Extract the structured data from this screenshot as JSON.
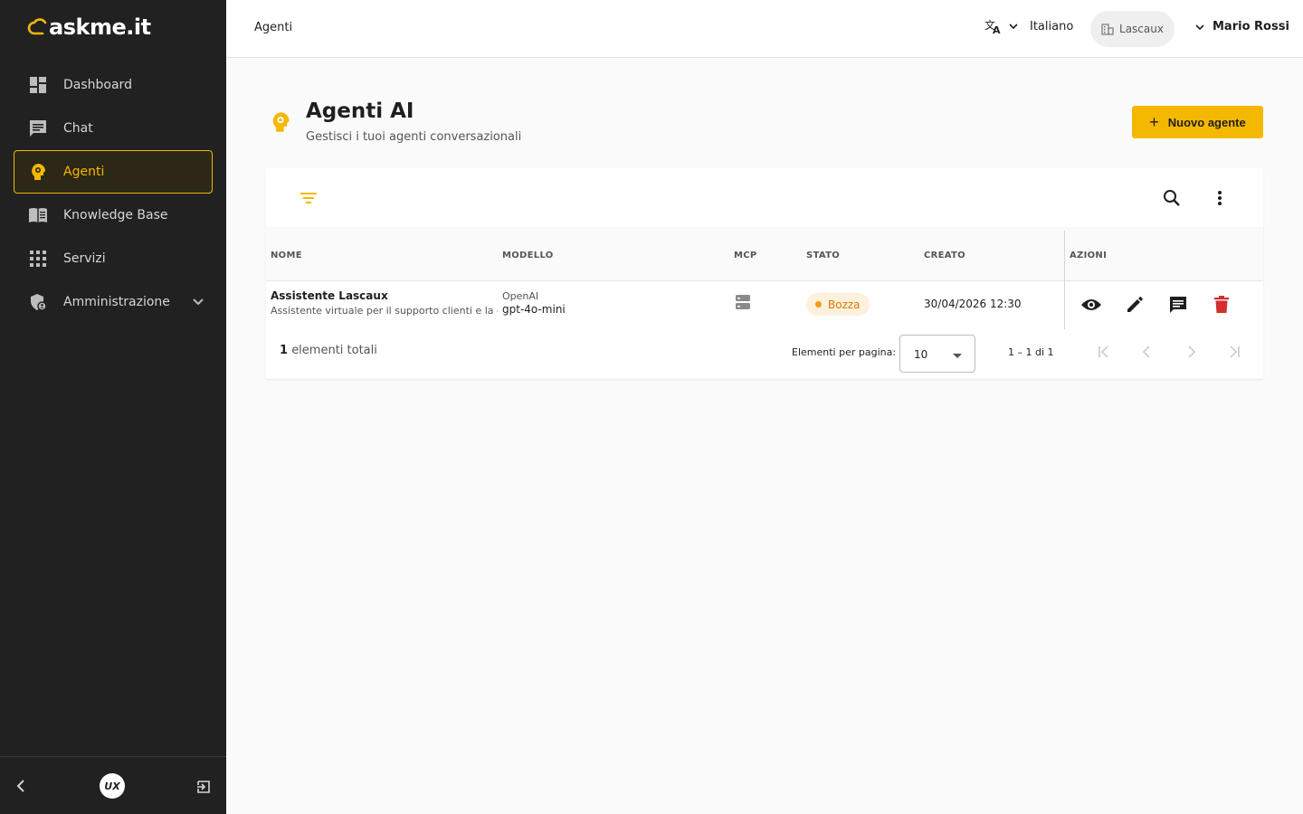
{
  "app": {
    "logo_text": "askme.it"
  },
  "sidebar": {
    "items": [
      {
        "label": "Dashboard",
        "icon": "dashboard-icon"
      },
      {
        "label": "Chat",
        "icon": "chat-icon"
      },
      {
        "label": "Agenti",
        "icon": "agent-icon",
        "active": true
      },
      {
        "label": "Knowledge Base",
        "icon": "book-icon"
      },
      {
        "label": "Servizi",
        "icon": "apps-grid-icon"
      },
      {
        "label": "Amministrazione",
        "icon": "admin-shield-icon",
        "expandable": true
      }
    ],
    "footer": {
      "collapse_icon": "chevron-left-icon",
      "brand_badge": "UX",
      "logout_icon": "logout-icon"
    }
  },
  "topbar": {
    "breadcrumb": "Agenti",
    "language": "Italiano",
    "organization": "Lascaux",
    "user": "Mario Rossi"
  },
  "page": {
    "title": "Agenti AI",
    "subtitle": "Gestisci i tuoi agenti conversazionali",
    "new_button": "Nuovo agente"
  },
  "table": {
    "columns": [
      "NOME",
      "MODELLO",
      "MCP",
      "STATO",
      "CREATO",
      "AZIONI"
    ],
    "rows": [
      {
        "name": "Assistente Lascaux",
        "description": "Assistente virtuale per il supporto clienti e la documentazione",
        "provider": "OpenAI",
        "model": "gpt-4o-mini",
        "status": "Bozza",
        "created": "30/04/2026 12:30"
      }
    ],
    "footer": {
      "total_count": "1",
      "total_label": "elementi totali",
      "per_page_label": "Elementi per pagina:",
      "per_page_value": "10",
      "range": "1 – 1 di 1"
    }
  },
  "colors": {
    "accent": "#f5b800",
    "sidebar_bg": "#212121",
    "status_draft": "#d97a00",
    "danger": "#d32f2f"
  }
}
